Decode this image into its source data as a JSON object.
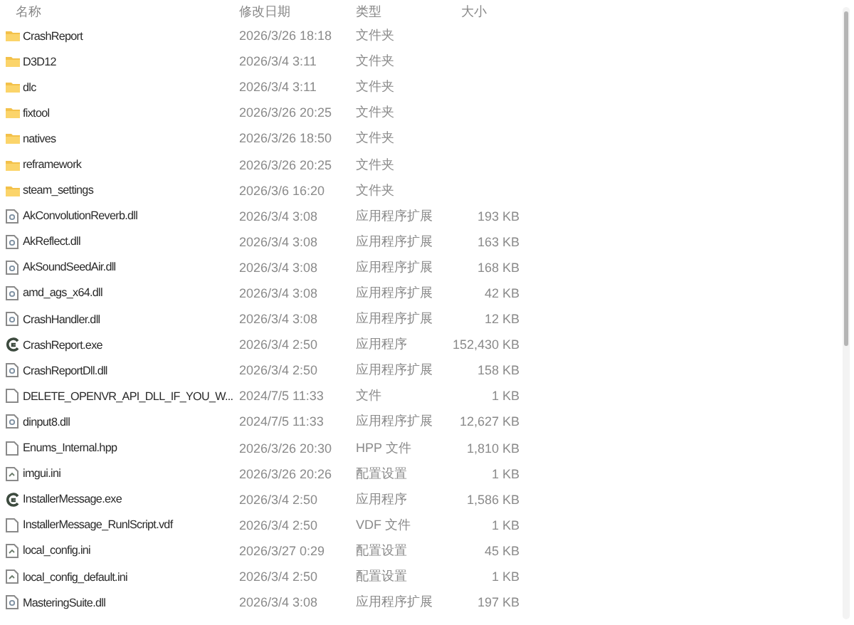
{
  "columns": [
    "名称",
    "修改日期",
    "类型",
    "大小"
  ],
  "files": [
    {
      "kind": "folder",
      "name": "CrashReport",
      "date": "2026/3/26 18:18",
      "type": "文件夹"
    },
    {
      "kind": "folder",
      "name": "D3D12",
      "date": "2026/3/4 3:11",
      "type": "文件夹"
    },
    {
      "kind": "folder",
      "name": "dlc",
      "date": "2026/3/4 3:11",
      "type": "文件夹"
    },
    {
      "kind": "folder",
      "name": "fixtool",
      "date": "2026/3/26 20:25",
      "type": "文件夹"
    },
    {
      "kind": "folder",
      "name": "natives",
      "date": "2026/3/26 18:50",
      "type": "文件夹"
    },
    {
      "kind": "folder",
      "name": "reframework",
      "date": "2026/3/26 20:25",
      "type": "文件夹"
    },
    {
      "kind": "folder",
      "name": "steam_settings",
      "date": "2026/3/6 16:20",
      "type": "文件夹"
    },
    {
      "kind": "dll",
      "name": "AkConvolutionReverb.dll",
      "date": "2026/3/4 3:08",
      "type": "应用程序扩展",
      "size": "193 KB"
    },
    {
      "kind": "dll",
      "name": "AkReflect.dll",
      "date": "2026/3/4 3:08",
      "type": "应用程序扩展",
      "size": "163 KB"
    },
    {
      "kind": "dll",
      "name": "AkSoundSeedAir.dll",
      "date": "2026/3/4 3:08",
      "type": "应用程序扩展",
      "size": "168 KB"
    },
    {
      "kind": "dll",
      "name": "amd_ags_x64.dll",
      "date": "2026/3/4 3:08",
      "type": "应用程序扩展",
      "size": "42 KB"
    },
    {
      "kind": "dll",
      "name": "CrashHandler.dll",
      "date": "2026/3/4 3:08",
      "type": "应用程序扩展",
      "size": "12 KB"
    },
    {
      "kind": "exe",
      "name": "CrashReport.exe",
      "date": "2026/3/4 2:50",
      "type": "应用程序",
      "size": "152,430 KB"
    },
    {
      "kind": "dll",
      "name": "CrashReportDll.dll",
      "date": "2026/3/4 2:50",
      "type": "应用程序扩展",
      "size": "158 KB"
    },
    {
      "kind": "file",
      "name": "DELETE_OPENVR_API_DLL_IF_YOU_W...",
      "date": "2024/7/5 11:33",
      "type": "文件",
      "size": "1 KB"
    },
    {
      "kind": "dll",
      "name": "dinput8.dll",
      "date": "2024/7/5 11:33",
      "type": "应用程序扩展",
      "size": "12,627 KB"
    },
    {
      "kind": "file",
      "name": "Enums_Internal.hpp",
      "date": "2026/3/26 20:30",
      "type": "HPP 文件",
      "size": "1,810 KB"
    },
    {
      "kind": "ini",
      "name": "imgui.ini",
      "date": "2026/3/26 20:26",
      "type": "配置设置",
      "size": "1 KB"
    },
    {
      "kind": "exe",
      "name": "InstallerMessage.exe",
      "date": "2026/3/4 2:50",
      "type": "应用程序",
      "size": "1,586 KB"
    },
    {
      "kind": "file",
      "name": "InstallerMessage_RunlScript.vdf",
      "date": "2026/3/4 2:50",
      "type": "VDF 文件",
      "size": "1 KB"
    },
    {
      "kind": "ini",
      "name": "local_config.ini",
      "date": "2026/3/27 0:29",
      "type": "配置设置",
      "size": "45 KB"
    },
    {
      "kind": "ini",
      "name": "local_config_default.ini",
      "date": "2026/3/4 2:50",
      "type": "配置设置",
      "size": "1 KB"
    },
    {
      "kind": "dll",
      "name": "MasteringSuite.dll",
      "date": "2026/3/4 3:08",
      "type": "应用程序扩展",
      "size": "197 KB"
    }
  ]
}
